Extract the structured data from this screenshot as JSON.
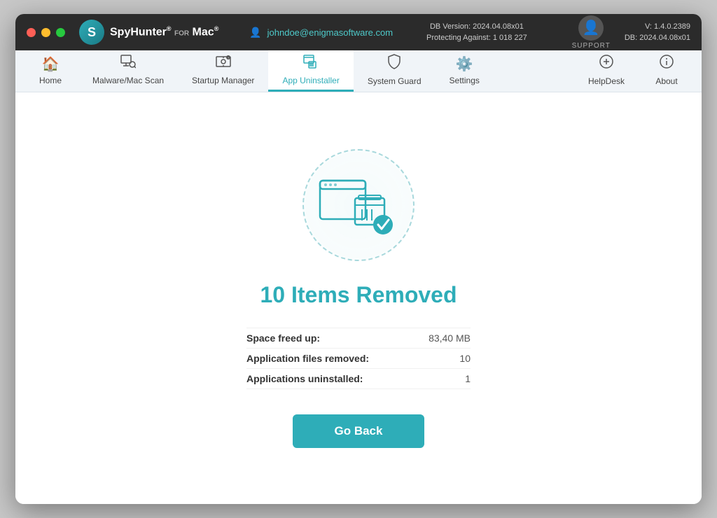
{
  "titlebar": {
    "user_email": "johndoe@enigmasoftware.com",
    "db_version_label": "DB Version: 2024.04.08x01",
    "protecting_label": "Protecting Against: 1 018 227",
    "support_label": "SUPPORT",
    "version_label": "V: 1.4.0.2389",
    "db_label": "DB:  2024.04.08x01",
    "logo_name": "SpyHunter",
    "logo_for": "FOR",
    "logo_mac": "Mac"
  },
  "navbar": {
    "items": [
      {
        "id": "home",
        "label": "Home",
        "icon": "🏠"
      },
      {
        "id": "malware",
        "label": "Malware/Mac Scan",
        "icon": "🔍"
      },
      {
        "id": "startup",
        "label": "Startup Manager",
        "icon": "⚙"
      },
      {
        "id": "uninstaller",
        "label": "App Uninstaller",
        "icon": "📋",
        "active": true
      },
      {
        "id": "systemguard",
        "label": "System Guard",
        "icon": "🛡"
      },
      {
        "id": "settings",
        "label": "Settings",
        "icon": "⚙"
      }
    ],
    "right_items": [
      {
        "id": "helpdesk",
        "label": "HelpDesk",
        "icon": "➕"
      },
      {
        "id": "about",
        "label": "About",
        "icon": "ℹ"
      }
    ]
  },
  "main": {
    "title": "10 Items Removed",
    "stats": [
      {
        "label": "Space freed up:",
        "value": "83,40 MB"
      },
      {
        "label": "Application files removed:",
        "value": "10"
      },
      {
        "label": "Applications uninstalled:",
        "value": "1"
      }
    ],
    "go_back_label": "Go Back"
  }
}
